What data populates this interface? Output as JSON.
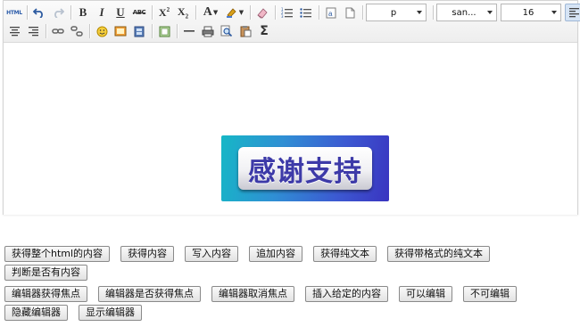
{
  "toolbar": {
    "html_icon_text": "HTML",
    "font_color_letter": "A",
    "format_select": "p",
    "font_family_select": "san...",
    "font_size_select": "16",
    "sigma": "Σ"
  },
  "content": {
    "banner_text": "感谢支持"
  },
  "actions": {
    "row1": [
      "获得整个html的内容",
      "获得内容",
      "写入内容",
      "追加内容",
      "获得纯文本",
      "获得带格式的纯文本",
      "判断是否有内容"
    ],
    "row2": [
      "编辑器获得焦点",
      "编辑器是否获得焦点",
      "编辑器取消焦点",
      "插入给定的内容",
      "可以编辑",
      "不可编辑",
      "隐藏编辑器",
      "显示编辑器"
    ]
  }
}
